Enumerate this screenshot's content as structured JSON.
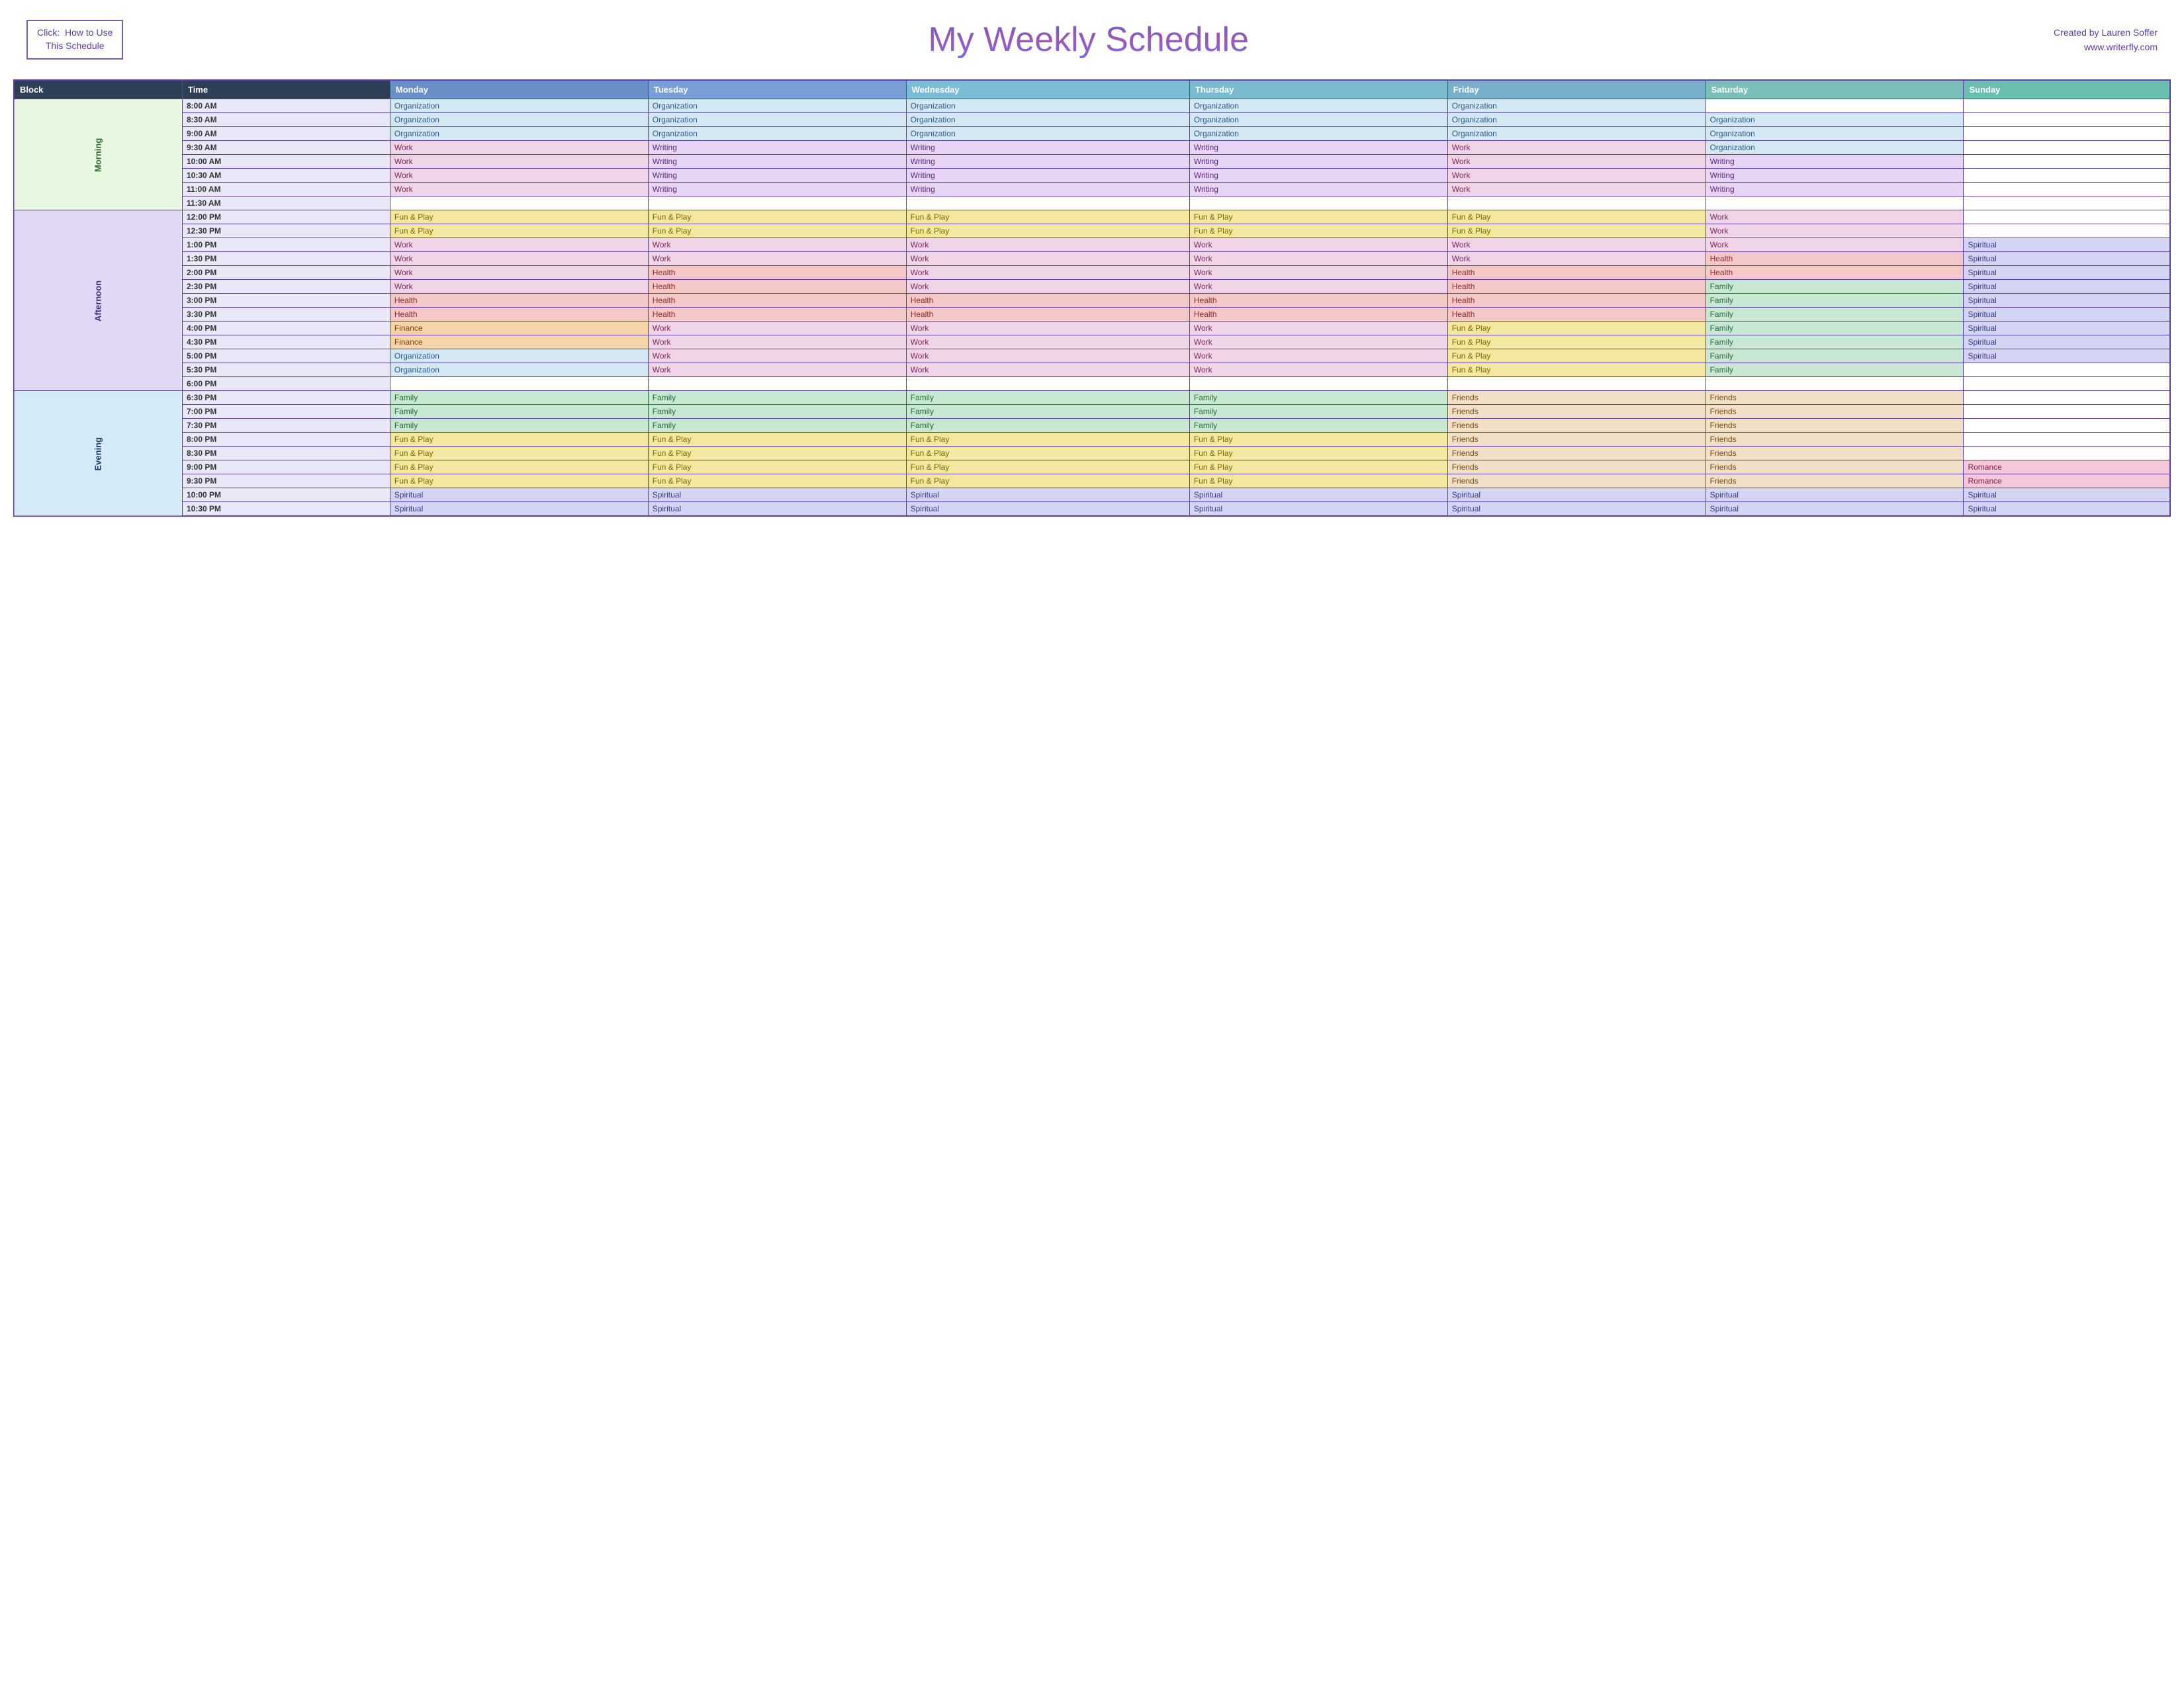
{
  "header": {
    "click_label": "Click:  How to Use\nThis Schedule",
    "title": "My Weekly Schedule",
    "credits_line1": "Created by Lauren Soffer",
    "credits_line2": "www.writerfly.com"
  },
  "table": {
    "columns": [
      "Block",
      "Time",
      "Monday",
      "Tuesday",
      "Wednesday",
      "Thursday",
      "Friday",
      "Saturday",
      "Sunday"
    ],
    "rows": [
      {
        "block": "Morning",
        "time": "8:00 AM",
        "mon": "Organization",
        "tue": "Organization",
        "wed": "Organization",
        "thu": "Organization",
        "fri": "Organization",
        "sat": "",
        "sun": ""
      },
      {
        "block": "",
        "time": "8:30 AM",
        "mon": "Organization",
        "tue": "Organization",
        "wed": "Organization",
        "thu": "Organization",
        "fri": "Organization",
        "sat": "Organization",
        "sun": ""
      },
      {
        "block": "",
        "time": "9:00 AM",
        "mon": "Organization",
        "tue": "Organization",
        "wed": "Organization",
        "thu": "Organization",
        "fri": "Organization",
        "sat": "Organization",
        "sun": ""
      },
      {
        "block": "",
        "time": "9:30 AM",
        "mon": "Work",
        "tue": "Writing",
        "wed": "Writing",
        "thu": "Writing",
        "fri": "Work",
        "sat": "Organization",
        "sun": ""
      },
      {
        "block": "",
        "time": "10:00 AM",
        "mon": "Work",
        "tue": "Writing",
        "wed": "Writing",
        "thu": "Writing",
        "fri": "Work",
        "sat": "Writing",
        "sun": ""
      },
      {
        "block": "",
        "time": "10:30 AM",
        "mon": "Work",
        "tue": "Writing",
        "wed": "Writing",
        "thu": "Writing",
        "fri": "Work",
        "sat": "Writing",
        "sun": ""
      },
      {
        "block": "",
        "time": "11:00 AM",
        "mon": "Work",
        "tue": "Writing",
        "wed": "Writing",
        "thu": "Writing",
        "fri": "Work",
        "sat": "Writing",
        "sun": ""
      },
      {
        "block": "",
        "time": "11:30 AM",
        "mon": "",
        "tue": "",
        "wed": "",
        "thu": "",
        "fri": "",
        "sat": "",
        "sun": ""
      },
      {
        "block": "Afternoon",
        "time": "12:00 PM",
        "mon": "Fun & Play",
        "tue": "Fun & Play",
        "wed": "Fun & Play",
        "thu": "Fun & Play",
        "fri": "Fun & Play",
        "sat": "Work",
        "sun": ""
      },
      {
        "block": "",
        "time": "12:30 PM",
        "mon": "Fun & Play",
        "tue": "Fun & Play",
        "wed": "Fun & Play",
        "thu": "Fun & Play",
        "fri": "Fun & Play",
        "sat": "Work",
        "sun": ""
      },
      {
        "block": "",
        "time": "1:00 PM",
        "mon": "Work",
        "tue": "Work",
        "wed": "Work",
        "thu": "Work",
        "fri": "Work",
        "sat": "Work",
        "sun": "Spiritual"
      },
      {
        "block": "",
        "time": "1:30 PM",
        "mon": "Work",
        "tue": "Work",
        "wed": "Work",
        "thu": "Work",
        "fri": "Work",
        "sat": "Health",
        "sun": "Spiritual"
      },
      {
        "block": "",
        "time": "2:00 PM",
        "mon": "Work",
        "tue": "Health",
        "wed": "Work",
        "thu": "Work",
        "fri": "Health",
        "sat": "Health",
        "sun": "Spiritual"
      },
      {
        "block": "",
        "time": "2:30 PM",
        "mon": "Work",
        "tue": "Health",
        "wed": "Work",
        "thu": "Work",
        "fri": "Health",
        "sat": "Family",
        "sun": "Spiritual"
      },
      {
        "block": "",
        "time": "3:00 PM",
        "mon": "Health",
        "tue": "Health",
        "wed": "Health",
        "thu": "Health",
        "fri": "Health",
        "sat": "Family",
        "sun": "Spiritual"
      },
      {
        "block": "",
        "time": "3:30 PM",
        "mon": "Health",
        "tue": "Health",
        "wed": "Health",
        "thu": "Health",
        "fri": "Health",
        "sat": "Family",
        "sun": "Spiritual"
      },
      {
        "block": "",
        "time": "4:00 PM",
        "mon": "Finance",
        "tue": "Work",
        "wed": "Work",
        "thu": "Work",
        "fri": "Fun & Play",
        "sat": "Family",
        "sun": "Spiritual"
      },
      {
        "block": "",
        "time": "4:30 PM",
        "mon": "Finance",
        "tue": "Work",
        "wed": "Work",
        "thu": "Work",
        "fri": "Fun & Play",
        "sat": "Family",
        "sun": "Spiritual"
      },
      {
        "block": "",
        "time": "5:00 PM",
        "mon": "Organization",
        "tue": "Work",
        "wed": "Work",
        "thu": "Work",
        "fri": "Fun & Play",
        "sat": "Family",
        "sun": "Spiritual"
      },
      {
        "block": "",
        "time": "5:30 PM",
        "mon": "Organization",
        "tue": "Work",
        "wed": "Work",
        "thu": "Work",
        "fri": "Fun & Play",
        "sat": "Family",
        "sun": ""
      },
      {
        "block": "",
        "time": "6:00 PM",
        "mon": "",
        "tue": "",
        "wed": "",
        "thu": "",
        "fri": "",
        "sat": "",
        "sun": ""
      },
      {
        "block": "Evening",
        "time": "6:30 PM",
        "mon": "Family",
        "tue": "Family",
        "wed": "Family",
        "thu": "Family",
        "fri": "Friends",
        "sat": "Friends",
        "sun": ""
      },
      {
        "block": "",
        "time": "7:00 PM",
        "mon": "Family",
        "tue": "Family",
        "wed": "Family",
        "thu": "Family",
        "fri": "Friends",
        "sat": "Friends",
        "sun": ""
      },
      {
        "block": "",
        "time": "7:30 PM",
        "mon": "Family",
        "tue": "Family",
        "wed": "Family",
        "thu": "Family",
        "fri": "Friends",
        "sat": "Friends",
        "sun": ""
      },
      {
        "block": "",
        "time": "8:00 PM",
        "mon": "Fun & Play",
        "tue": "Fun & Play",
        "wed": "Fun & Play",
        "thu": "Fun & Play",
        "fri": "Friends",
        "sat": "Friends",
        "sun": ""
      },
      {
        "block": "",
        "time": "8:30 PM",
        "mon": "Fun & Play",
        "tue": "Fun & Play",
        "wed": "Fun & Play",
        "thu": "Fun & Play",
        "fri": "Friends",
        "sat": "Friends",
        "sun": ""
      },
      {
        "block": "",
        "time": "9:00 PM",
        "mon": "Fun & Play",
        "tue": "Fun & Play",
        "wed": "Fun & Play",
        "thu": "Fun & Play",
        "fri": "Friends",
        "sat": "Friends",
        "sun": "Romance"
      },
      {
        "block": "",
        "time": "9:30 PM",
        "mon": "Fun & Play",
        "tue": "Fun & Play",
        "wed": "Fun & Play",
        "thu": "Fun & Play",
        "fri": "Friends",
        "sat": "Friends",
        "sun": "Romance"
      },
      {
        "block": "",
        "time": "10:00 PM",
        "mon": "Spiritual",
        "tue": "Spiritual",
        "wed": "Spiritual",
        "thu": "Spiritual",
        "fri": "Spiritual",
        "sat": "Spiritual",
        "sun": "Spiritual"
      },
      {
        "block": "",
        "time": "10:30 PM",
        "mon": "Spiritual",
        "tue": "Spiritual",
        "wed": "Spiritual",
        "thu": "Spiritual",
        "fri": "Spiritual",
        "sat": "Spiritual",
        "sun": "Spiritual"
      }
    ]
  }
}
